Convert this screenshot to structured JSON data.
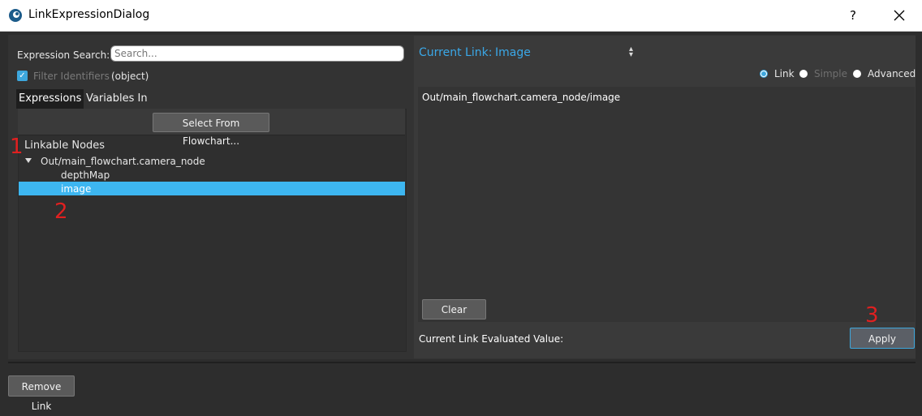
{
  "window": {
    "title": "LinkExpressionDialog",
    "help_glyph": "?",
    "close_glyph": "×"
  },
  "left": {
    "search_label": "Expression Search:",
    "search_placeholder": "Search...",
    "search_value": "",
    "filter_label": "Filter Identifiers",
    "filter_checked": true,
    "filter_type": "(object)",
    "tabs": [
      {
        "label": "Expressions",
        "active": true
      },
      {
        "label": "Variables In",
        "active": false
      }
    ],
    "select_flowchart_label": "Select From Flowchart...",
    "tree": {
      "root": "Linkable Nodes",
      "node": "Out/main_flowchart.camera_node",
      "children": [
        "depthMap",
        "image"
      ],
      "selected": "image"
    }
  },
  "right": {
    "current_link_label": "Current Link:",
    "current_link_value": "Image",
    "modes": [
      {
        "label": "Link",
        "selected": true,
        "enabled": true
      },
      {
        "label": "Simple",
        "selected": false,
        "enabled": false
      },
      {
        "label": "Advanced",
        "selected": false,
        "enabled": true
      }
    ],
    "expression_text": "Out/main_flowchart.camera_node/image",
    "clear_label": "Clear",
    "evaluated_label": "Current Link Evaluated Value:",
    "apply_label": "Apply"
  },
  "bottom": {
    "remove_link_label": "Remove Link"
  },
  "annotations": [
    "1",
    "2",
    "3"
  ],
  "colors": {
    "accent": "#3da7dd",
    "selection": "#3db6f0",
    "annotation": "#e02020",
    "background": "#2d2d2d"
  }
}
